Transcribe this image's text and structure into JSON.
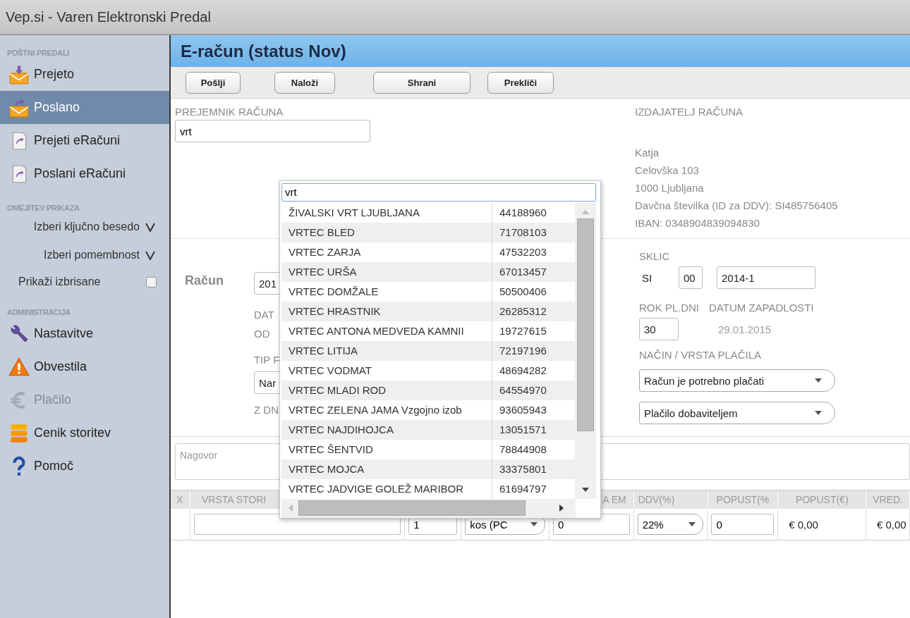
{
  "window": {
    "title": "Vep.si - Varen Elektronski Predal"
  },
  "sidebar": {
    "mailboxes": {
      "heading": "POŠTNI PREDALI",
      "items": [
        {
          "label": "Prejeto",
          "selected": false
        },
        {
          "label": "Poslano",
          "selected": true
        },
        {
          "label": "Prejeti eRačuni",
          "selected": false
        },
        {
          "label": "Poslani eRačuni",
          "selected": false
        }
      ]
    },
    "filters": {
      "heading": "OMEJITEV PRIKAZA",
      "items": [
        {
          "kind": "dropdown",
          "label": "Izberi ključno besedo"
        },
        {
          "kind": "dropdown",
          "label": "Izberi pomembnost"
        },
        {
          "kind": "checkbox",
          "label": "Prikaži izbrisane",
          "checked": false
        }
      ]
    },
    "admin": {
      "heading": "ADMINISTRACIJA",
      "items": [
        {
          "label": "Nastavitve",
          "disabled": false
        },
        {
          "label": "Obvestila",
          "disabled": false
        },
        {
          "label": "Plačilo",
          "disabled": true
        },
        {
          "label": "Cenik storitev",
          "disabled": false
        },
        {
          "label": "Pomoč",
          "disabled": false
        }
      ]
    }
  },
  "page": {
    "title": "E-račun (status Nov)",
    "toolbar": [
      "Pošlji",
      "Naloži",
      "Shrani",
      "Prekliči"
    ]
  },
  "recipient": {
    "label": "PREJEMNIK RAČUNA",
    "value": "vrt"
  },
  "issuer": {
    "label": "IZDAJATELJ RAČUNA",
    "lines": [
      "Katja",
      "Celovška 103",
      "1000 Ljubljana",
      "Davčna številka (ID za DDV): SI485756405",
      "IBAN: 0348904839094830"
    ]
  },
  "invoice": {
    "label": "Račun",
    "number": "201",
    "date_label": "DAT",
    "from_label": "OD",
    "type_label": "TIP F",
    "type_value": "Nar",
    "days_label": "Z DN"
  },
  "reference": {
    "label": "SKLIC",
    "prefix": "SI",
    "model": "00",
    "number": "2014-1"
  },
  "due": {
    "days_label": "ROK PL.DNI",
    "days": "30",
    "date_label": "DATUM ZAPADLOSTI",
    "date": "29.01.2015"
  },
  "payment": {
    "label": "NAČIN / VRSTA PLAČILA",
    "options": [
      "Račun je potrebno plačati",
      "Plačilo dobaviteljem"
    ]
  },
  "greeting": {
    "placeholder": "Nagovor"
  },
  "items_table": {
    "columns": [
      "X",
      "VRSTA STORI",
      "A EM",
      "DDV(%)",
      "POPUST(%",
      "POPUST(€)",
      "VRED."
    ],
    "row": [
      {
        "kind": "blank"
      },
      {
        "kind": "input"
      },
      {
        "kind": "input",
        "value": "1"
      },
      {
        "kind": "select",
        "value": "kos (PC"
      },
      {
        "kind": "input",
        "value": "0"
      },
      {
        "kind": "select",
        "value": "22%"
      },
      {
        "kind": "input",
        "value": "0"
      },
      {
        "kind": "text",
        "value": "€ 0,00"
      },
      {
        "kind": "text",
        "value": "€ 0,00"
      }
    ]
  },
  "lookup": {
    "query": "vrt",
    "results": [
      {
        "name": "ŽIVALSKI VRT LJUBLJANA",
        "number": "44188960"
      },
      {
        "name": "VRTEC BLED",
        "number": "71708103"
      },
      {
        "name": "VRTEC ZARJA",
        "number": "47532203"
      },
      {
        "name": "VRTEC URŠA",
        "number": "67013457"
      },
      {
        "name": "VRTEC DOMŽALE",
        "number": "50500406"
      },
      {
        "name": "VRTEC HRASTNIK",
        "number": "26285312"
      },
      {
        "name": "VRTEC ANTONA MEDVEDA KAMNII",
        "number": "19727615"
      },
      {
        "name": "VRTEC LITIJA",
        "number": "72197196"
      },
      {
        "name": "VRTEC VODMAT",
        "number": "48694282"
      },
      {
        "name": "VRTEC MLADI ROD",
        "number": "64554970"
      },
      {
        "name": "VRTEC ZELENA JAMA Vzgojno izob",
        "number": "93605943"
      },
      {
        "name": "VRTEC NAJDIHOJCA",
        "number": "13051571"
      },
      {
        "name": "VRTEC ŠENTVID",
        "number": "78844908"
      },
      {
        "name": "VRTEC MOJCA",
        "number": "33375801"
      },
      {
        "name": "VRTEC JADVIGE GOLEŽ MARIBOR",
        "number": "61694797"
      }
    ]
  }
}
